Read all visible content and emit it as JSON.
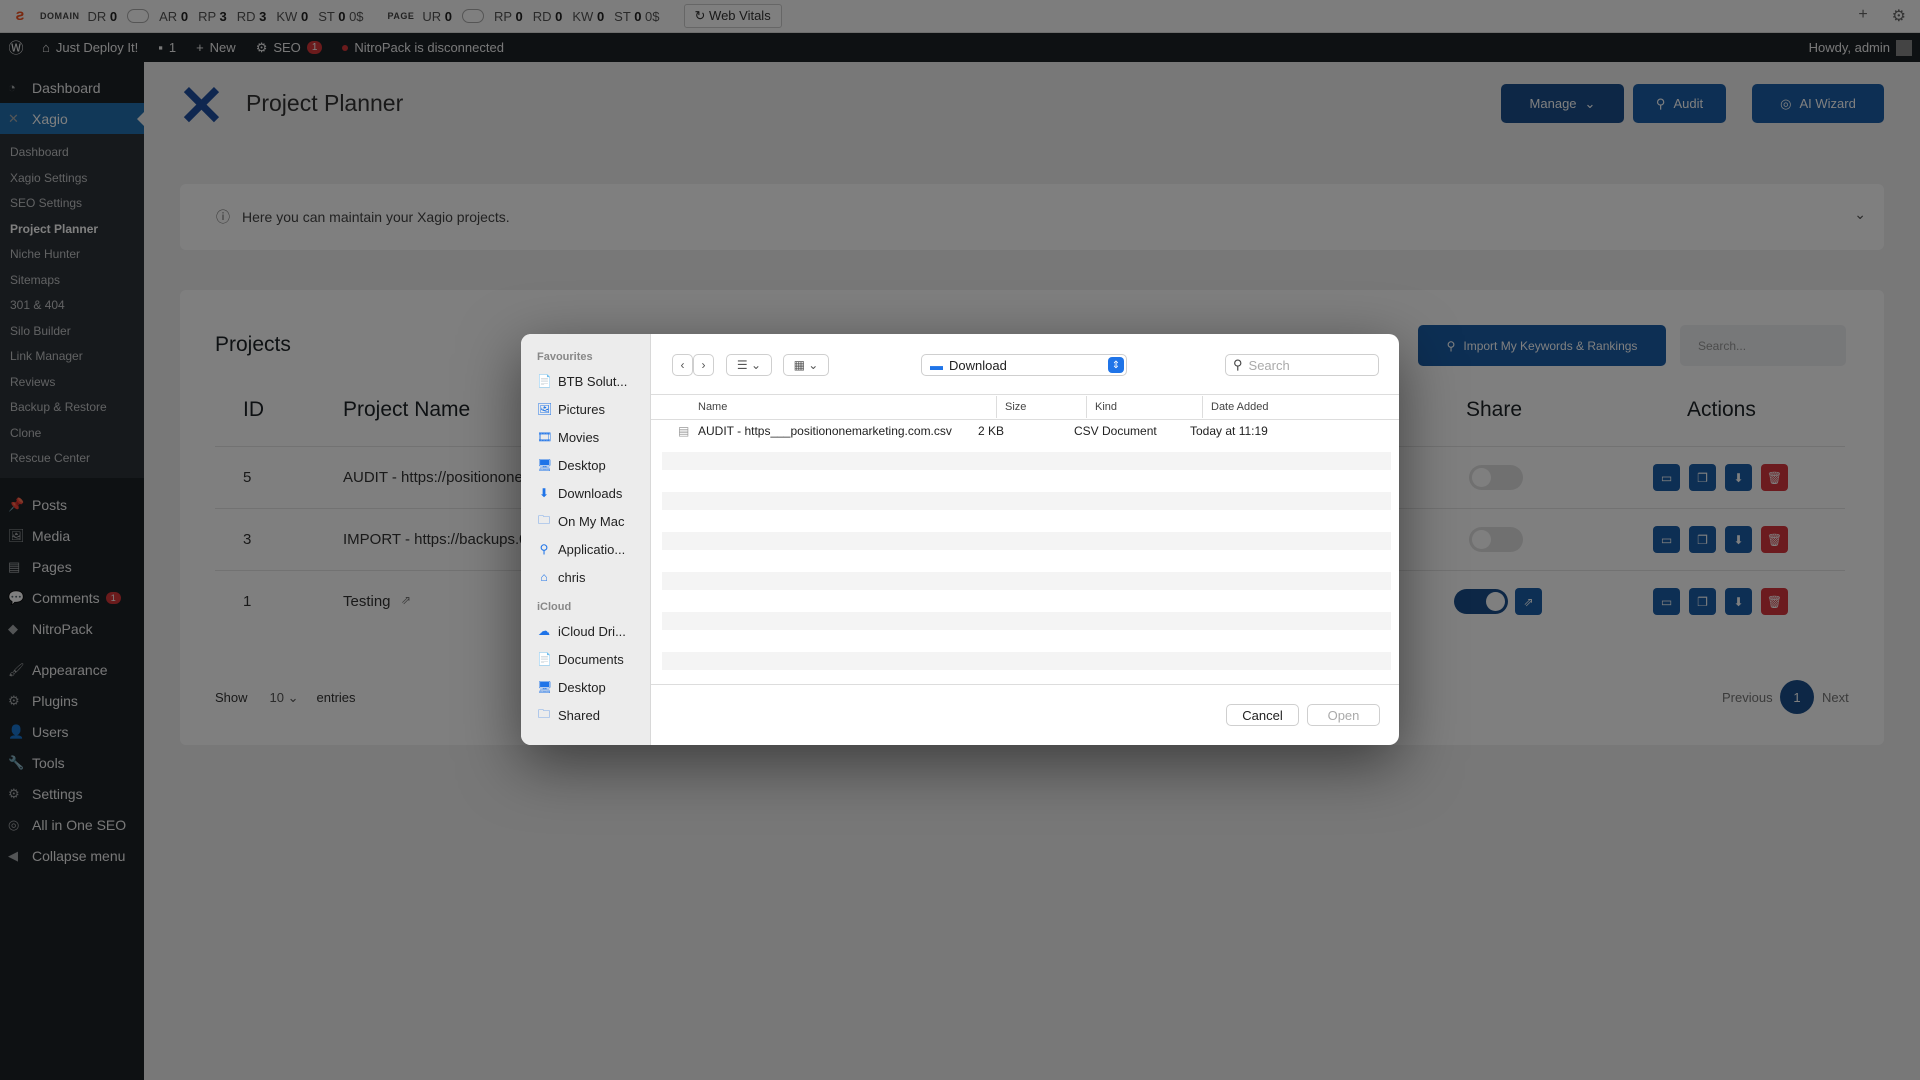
{
  "seo_bar": {
    "domain_label": "DOMAIN",
    "domain_metrics": [
      {
        "k": "DR",
        "v": "0"
      },
      {
        "k": "AR",
        "v": "0"
      },
      {
        "k": "RP",
        "v": "3"
      },
      {
        "k": "RD",
        "v": "3"
      },
      {
        "k": "KW",
        "v": "0"
      },
      {
        "k": "ST",
        "v": "0",
        "suffix": "0$"
      }
    ],
    "page_label": "PAGE",
    "page_metrics": [
      {
        "k": "UR",
        "v": "0"
      },
      {
        "k": "RP",
        "v": "0"
      },
      {
        "k": "RD",
        "v": "0"
      },
      {
        "k": "KW",
        "v": "0"
      },
      {
        "k": "ST",
        "v": "0",
        "suffix": "0$"
      }
    ],
    "web_vitals": "Web Vitals"
  },
  "admin_bar": {
    "site_name": "Just Deploy It!",
    "comments_count": "1",
    "new_label": "New",
    "seo_label": "SEO",
    "seo_badge": "1",
    "nitropack": "NitroPack is disconnected",
    "howdy": "Howdy, admin"
  },
  "sidebar": {
    "dashboard": "Dashboard",
    "xagio": "Xagio",
    "submenu": [
      "Dashboard",
      "Xagio Settings",
      "SEO Settings",
      "Project Planner",
      "Niche Hunter",
      "Sitemaps",
      "301 & 404",
      "Silo Builder",
      "Link Manager",
      "Reviews",
      "Backup & Restore",
      "Clone",
      "Rescue Center"
    ],
    "items": [
      {
        "icon": "📌",
        "label": "Posts"
      },
      {
        "icon": "🖼",
        "label": "Media"
      },
      {
        "icon": "▤",
        "label": "Pages"
      },
      {
        "icon": "💬",
        "label": "Comments",
        "badge": "1"
      },
      {
        "icon": "◆",
        "label": "NitroPack"
      }
    ],
    "items2": [
      {
        "icon": "🖌",
        "label": "Appearance"
      },
      {
        "icon": "⚙",
        "label": "Plugins"
      },
      {
        "icon": "👤",
        "label": "Users"
      },
      {
        "icon": "🔧",
        "label": "Tools"
      },
      {
        "icon": "⚙",
        "label": "Settings"
      },
      {
        "icon": "◎",
        "label": "All in One SEO"
      },
      {
        "icon": "◀",
        "label": "Collapse menu"
      }
    ]
  },
  "page": {
    "title": "Project Planner",
    "manage": "Manage",
    "audit": "Audit",
    "ai_wizard": "AI Wizard",
    "info": "Here you can maintain your Xagio projects.",
    "projects_title": "Projects",
    "import_btn": "Import My Keywords & Rankings",
    "search_placeholder": "Search...",
    "col_id": "ID",
    "col_name": "Project Name",
    "col_share": "Share",
    "col_actions": "Actions",
    "rows": [
      {
        "id": "5",
        "name": "AUDIT - https://positionone",
        "shared": false
      },
      {
        "id": "3",
        "name": "IMPORT - https://backups.0",
        "shared": false
      },
      {
        "id": "1",
        "name": "Testing",
        "shared": true
      }
    ],
    "show": "Show",
    "entries_value": "10",
    "entries": "entries",
    "previous": "Previous",
    "page_num": "1",
    "next": "Next"
  },
  "dialog": {
    "favourites_label": "Favourites",
    "favourites": [
      {
        "icon": "📄",
        "label": "BTB Solut..."
      },
      {
        "icon": "🖼",
        "label": "Pictures"
      },
      {
        "icon": "🎞",
        "label": "Movies"
      },
      {
        "icon": "🖥",
        "label": "Desktop"
      },
      {
        "icon": "⬇",
        "label": "Downloads"
      },
      {
        "icon": "🗀",
        "label": "On My Mac"
      },
      {
        "icon": "⚲",
        "label": "Applicatio..."
      },
      {
        "icon": "⌂",
        "label": "chris"
      }
    ],
    "icloud_label": "iCloud",
    "icloud": [
      {
        "icon": "☁",
        "label": "iCloud Dri..."
      },
      {
        "icon": "📄",
        "label": "Documents"
      },
      {
        "icon": "🖥",
        "label": "Desktop"
      },
      {
        "icon": "🗀",
        "label": "Shared"
      }
    ],
    "location": "Download",
    "search_placeholder": "Search",
    "columns": {
      "name": "Name",
      "size": "Size",
      "kind": "Kind",
      "date": "Date Added"
    },
    "file": {
      "name": "AUDIT  - https___positiononemarketing.com.csv",
      "size": "2 KB",
      "kind": "CSV Document",
      "date": "Today at 11:19"
    },
    "cancel": "Cancel",
    "open": "Open"
  }
}
